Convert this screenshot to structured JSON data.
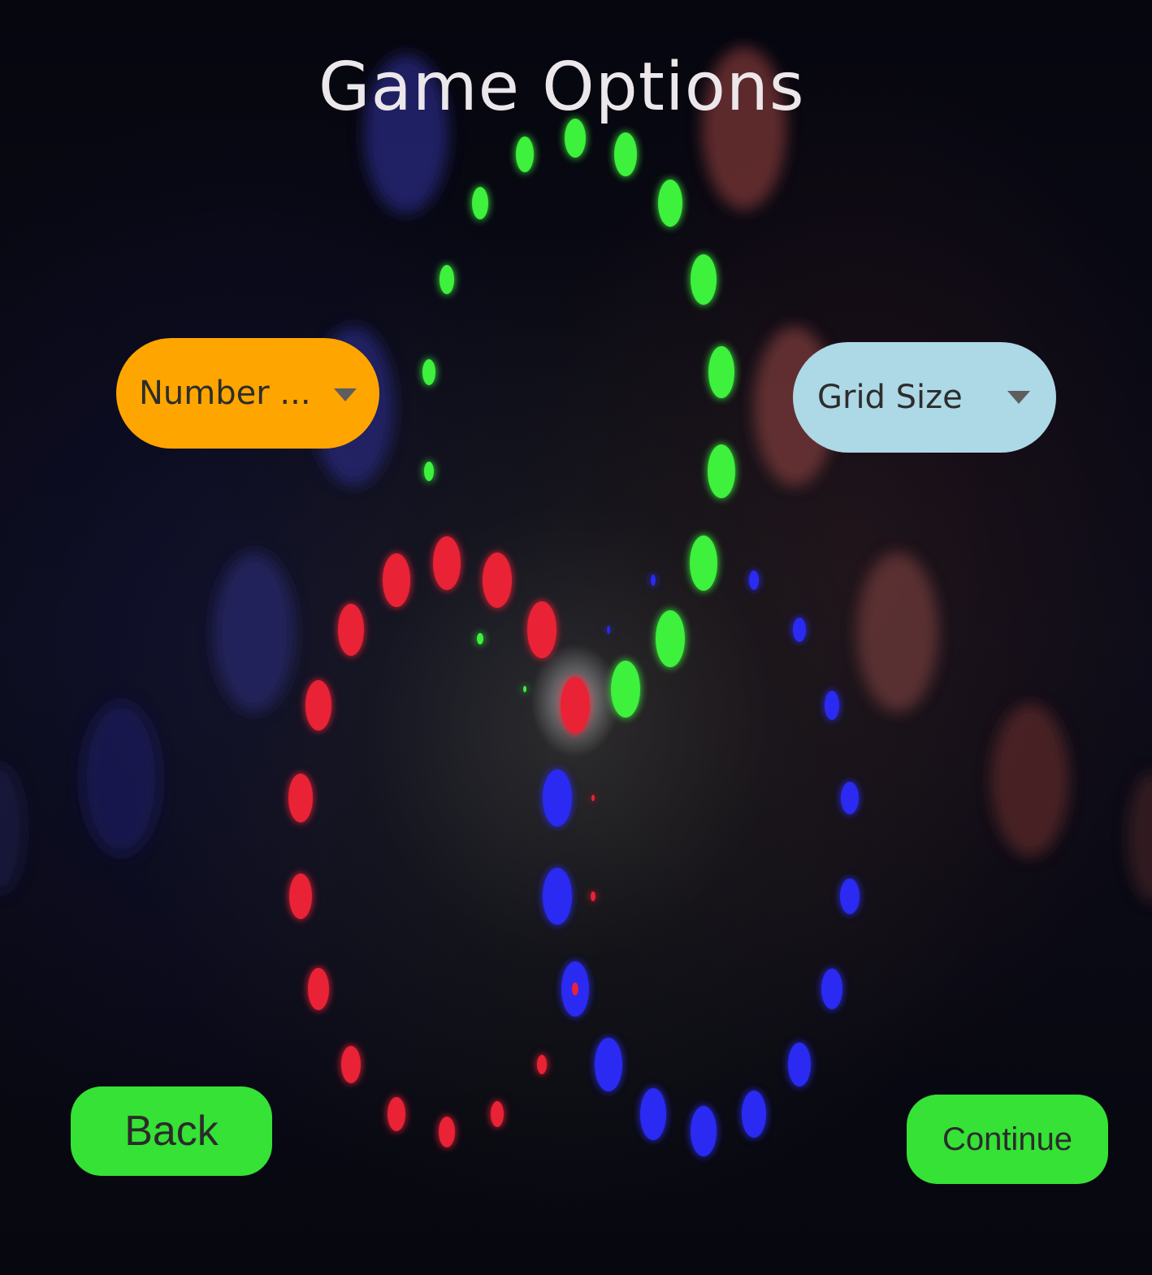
{
  "title": "Game Options",
  "dropdowns": {
    "players": {
      "label": "Number ..."
    },
    "grid": {
      "label": "Grid Size"
    }
  },
  "buttons": {
    "back": "Back",
    "continue": "Continue"
  },
  "colors": {
    "players_dropdown": "#ffa500",
    "grid_dropdown": "#add8e6",
    "button": "#35e235",
    "dot_green": "#3ef13e",
    "dot_red": "#ea2236",
    "dot_blue": "#2a2bf2"
  }
}
